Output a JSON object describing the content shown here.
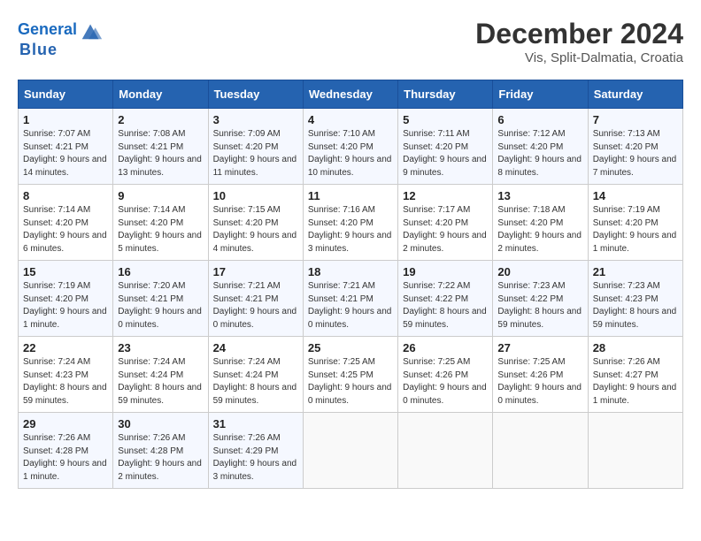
{
  "header": {
    "logo_general": "General",
    "logo_blue": "Blue",
    "month_title": "December 2024",
    "subtitle": "Vis, Split-Dalmatia, Croatia"
  },
  "weekdays": [
    "Sunday",
    "Monday",
    "Tuesday",
    "Wednesday",
    "Thursday",
    "Friday",
    "Saturday"
  ],
  "weeks": [
    [
      {
        "day": "1",
        "sunrise": "7:07 AM",
        "sunset": "4:21 PM",
        "daylight": "9 hours and 14 minutes."
      },
      {
        "day": "2",
        "sunrise": "7:08 AM",
        "sunset": "4:21 PM",
        "daylight": "9 hours and 13 minutes."
      },
      {
        "day": "3",
        "sunrise": "7:09 AM",
        "sunset": "4:20 PM",
        "daylight": "9 hours and 11 minutes."
      },
      {
        "day": "4",
        "sunrise": "7:10 AM",
        "sunset": "4:20 PM",
        "daylight": "9 hours and 10 minutes."
      },
      {
        "day": "5",
        "sunrise": "7:11 AM",
        "sunset": "4:20 PM",
        "daylight": "9 hours and 9 minutes."
      },
      {
        "day": "6",
        "sunrise": "7:12 AM",
        "sunset": "4:20 PM",
        "daylight": "9 hours and 8 minutes."
      },
      {
        "day": "7",
        "sunrise": "7:13 AM",
        "sunset": "4:20 PM",
        "daylight": "9 hours and 7 minutes."
      }
    ],
    [
      {
        "day": "8",
        "sunrise": "7:14 AM",
        "sunset": "4:20 PM",
        "daylight": "9 hours and 6 minutes."
      },
      {
        "day": "9",
        "sunrise": "7:14 AM",
        "sunset": "4:20 PM",
        "daylight": "9 hours and 5 minutes."
      },
      {
        "day": "10",
        "sunrise": "7:15 AM",
        "sunset": "4:20 PM",
        "daylight": "9 hours and 4 minutes."
      },
      {
        "day": "11",
        "sunrise": "7:16 AM",
        "sunset": "4:20 PM",
        "daylight": "9 hours and 3 minutes."
      },
      {
        "day": "12",
        "sunrise": "7:17 AM",
        "sunset": "4:20 PM",
        "daylight": "9 hours and 2 minutes."
      },
      {
        "day": "13",
        "sunrise": "7:18 AM",
        "sunset": "4:20 PM",
        "daylight": "9 hours and 2 minutes."
      },
      {
        "day": "14",
        "sunrise": "7:19 AM",
        "sunset": "4:20 PM",
        "daylight": "9 hours and 1 minute."
      }
    ],
    [
      {
        "day": "15",
        "sunrise": "7:19 AM",
        "sunset": "4:20 PM",
        "daylight": "9 hours and 1 minute."
      },
      {
        "day": "16",
        "sunrise": "7:20 AM",
        "sunset": "4:21 PM",
        "daylight": "9 hours and 0 minutes."
      },
      {
        "day": "17",
        "sunrise": "7:21 AM",
        "sunset": "4:21 PM",
        "daylight": "9 hours and 0 minutes."
      },
      {
        "day": "18",
        "sunrise": "7:21 AM",
        "sunset": "4:21 PM",
        "daylight": "9 hours and 0 minutes."
      },
      {
        "day": "19",
        "sunrise": "7:22 AM",
        "sunset": "4:22 PM",
        "daylight": "8 hours and 59 minutes."
      },
      {
        "day": "20",
        "sunrise": "7:23 AM",
        "sunset": "4:22 PM",
        "daylight": "8 hours and 59 minutes."
      },
      {
        "day": "21",
        "sunrise": "7:23 AM",
        "sunset": "4:23 PM",
        "daylight": "8 hours and 59 minutes."
      }
    ],
    [
      {
        "day": "22",
        "sunrise": "7:24 AM",
        "sunset": "4:23 PM",
        "daylight": "8 hours and 59 minutes."
      },
      {
        "day": "23",
        "sunrise": "7:24 AM",
        "sunset": "4:24 PM",
        "daylight": "8 hours and 59 minutes."
      },
      {
        "day": "24",
        "sunrise": "7:24 AM",
        "sunset": "4:24 PM",
        "daylight": "8 hours and 59 minutes."
      },
      {
        "day": "25",
        "sunrise": "7:25 AM",
        "sunset": "4:25 PM",
        "daylight": "9 hours and 0 minutes."
      },
      {
        "day": "26",
        "sunrise": "7:25 AM",
        "sunset": "4:26 PM",
        "daylight": "9 hours and 0 minutes."
      },
      {
        "day": "27",
        "sunrise": "7:25 AM",
        "sunset": "4:26 PM",
        "daylight": "9 hours and 0 minutes."
      },
      {
        "day": "28",
        "sunrise": "7:26 AM",
        "sunset": "4:27 PM",
        "daylight": "9 hours and 1 minute."
      }
    ],
    [
      {
        "day": "29",
        "sunrise": "7:26 AM",
        "sunset": "4:28 PM",
        "daylight": "9 hours and 1 minute."
      },
      {
        "day": "30",
        "sunrise": "7:26 AM",
        "sunset": "4:28 PM",
        "daylight": "9 hours and 2 minutes."
      },
      {
        "day": "31",
        "sunrise": "7:26 AM",
        "sunset": "4:29 PM",
        "daylight": "9 hours and 3 minutes."
      },
      null,
      null,
      null,
      null
    ]
  ]
}
